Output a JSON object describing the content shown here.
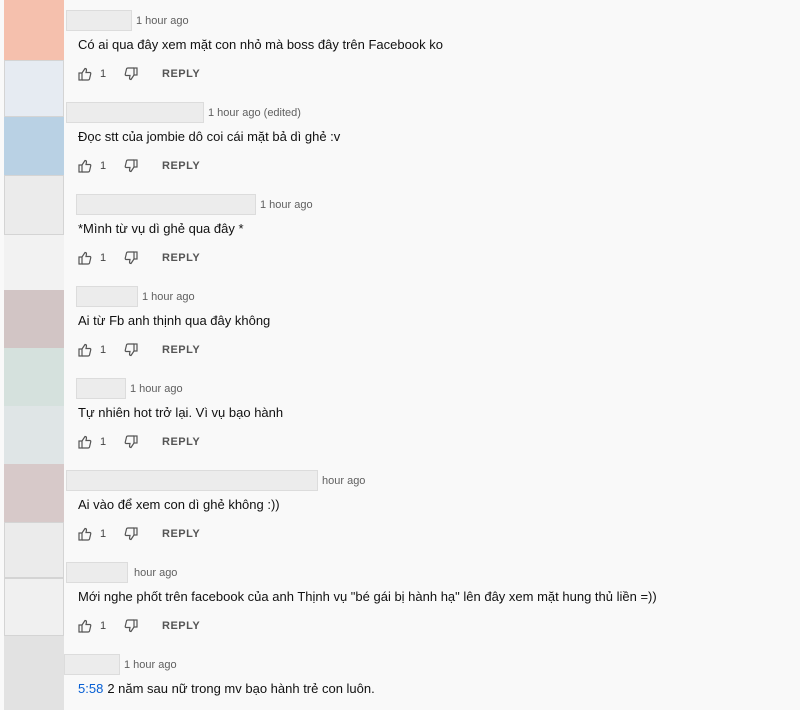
{
  "avatar_colors": [
    "#f5c0ad",
    "#e6ebf2",
    "#b9d1e4",
    "#ebebeb",
    "#f2f2f2",
    "#d2c5c5",
    "#d5e1dd",
    "#dfe5e6",
    "#d7c9c9",
    "#ebebeb",
    "#f0f0f0",
    "#e2e2e2"
  ],
  "actions": {
    "reply_label": "REPLY"
  },
  "comments": [
    {
      "time": "1 hour ago",
      "text": "Có ai qua đây xem mặt con nhỏ mà boss đây trên Facebook ko",
      "likes": "1"
    },
    {
      "time": "1 hour ago (edited)",
      "text": "Đọc stt của jombie dô coi cái mặt bả dì ghẻ :v",
      "likes": "1"
    },
    {
      "time": "1 hour ago",
      "text": "*Mình từ vụ dì ghẻ qua đây *",
      "likes": "1"
    },
    {
      "time": "1 hour ago",
      "text": "Ai từ Fb anh thịnh qua đây không",
      "likes": "1"
    },
    {
      "time": "1 hour ago",
      "text": "Tự nhiên hot trở lại. Vì vụ bạo hành",
      "likes": "1"
    },
    {
      "time": "hour ago",
      "text": "Ai vào để xem con dì ghẻ không :))",
      "likes": "1"
    },
    {
      "time": "hour ago",
      "text": "Mới nghe phốt trên facebook của anh Thịnh vụ \"bé gái bị hành hạ\" lên đây xem mặt hung thủ liền =))",
      "likes": "1"
    },
    {
      "time": "1 hour ago",
      "timestamp_link": "5:58",
      "text": "2 năm sau nữ trong mv bạo hành trẻ con luôn."
    }
  ]
}
